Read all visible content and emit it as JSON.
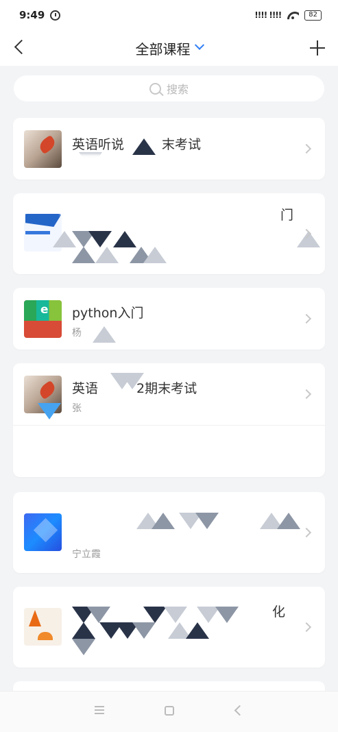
{
  "status_bar": {
    "time": "9:49",
    "signal_text": "!!!! !!!!",
    "battery": "82",
    "alarm_icon": "alarm-clock-icon",
    "wifi_icon": "wifi-icon"
  },
  "nav": {
    "title": "全部课程",
    "back_icon": "chevron-left-icon",
    "dropdown_icon": "chevron-down-icon",
    "add_icon": "plus-icon",
    "accent_color": "#2f7ef5"
  },
  "search": {
    "placeholder": "搜索"
  },
  "courses": [
    {
      "title_left": "英语听说",
      "title_right": "末考试"
    },
    {
      "title_right": "门"
    },
    {
      "title": "python入门",
      "subtitle": "杨"
    },
    {
      "title_left": "英语",
      "title_right": "2期末考试",
      "subtitle": "张"
    },
    {
      "subtitle": "宁立霞"
    },
    {
      "title_right": "化"
    }
  ]
}
